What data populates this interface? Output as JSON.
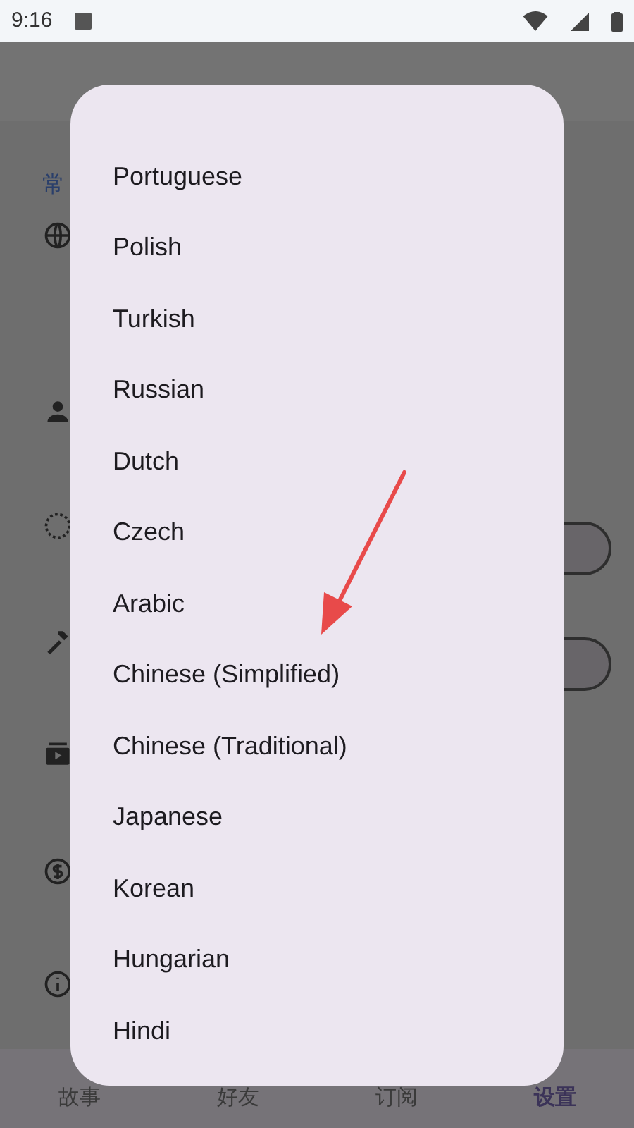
{
  "status_bar": {
    "time": "9:16"
  },
  "section_header": "常",
  "language_dialog": {
    "options": [
      {
        "label": "Portuguese"
      },
      {
        "label": "Polish"
      },
      {
        "label": "Turkish"
      },
      {
        "label": "Russian"
      },
      {
        "label": "Dutch"
      },
      {
        "label": "Czech"
      },
      {
        "label": "Arabic"
      },
      {
        "label": "Chinese (Simplified)"
      },
      {
        "label": "Chinese (Traditional)"
      },
      {
        "label": "Japanese"
      },
      {
        "label": "Korean"
      },
      {
        "label": "Hungarian"
      },
      {
        "label": "Hindi"
      }
    ]
  },
  "bottom_nav": [
    {
      "label": "故事",
      "selected": false
    },
    {
      "label": "好友",
      "selected": false
    },
    {
      "label": "订阅",
      "selected": false
    },
    {
      "label": "设置",
      "selected": true
    }
  ]
}
